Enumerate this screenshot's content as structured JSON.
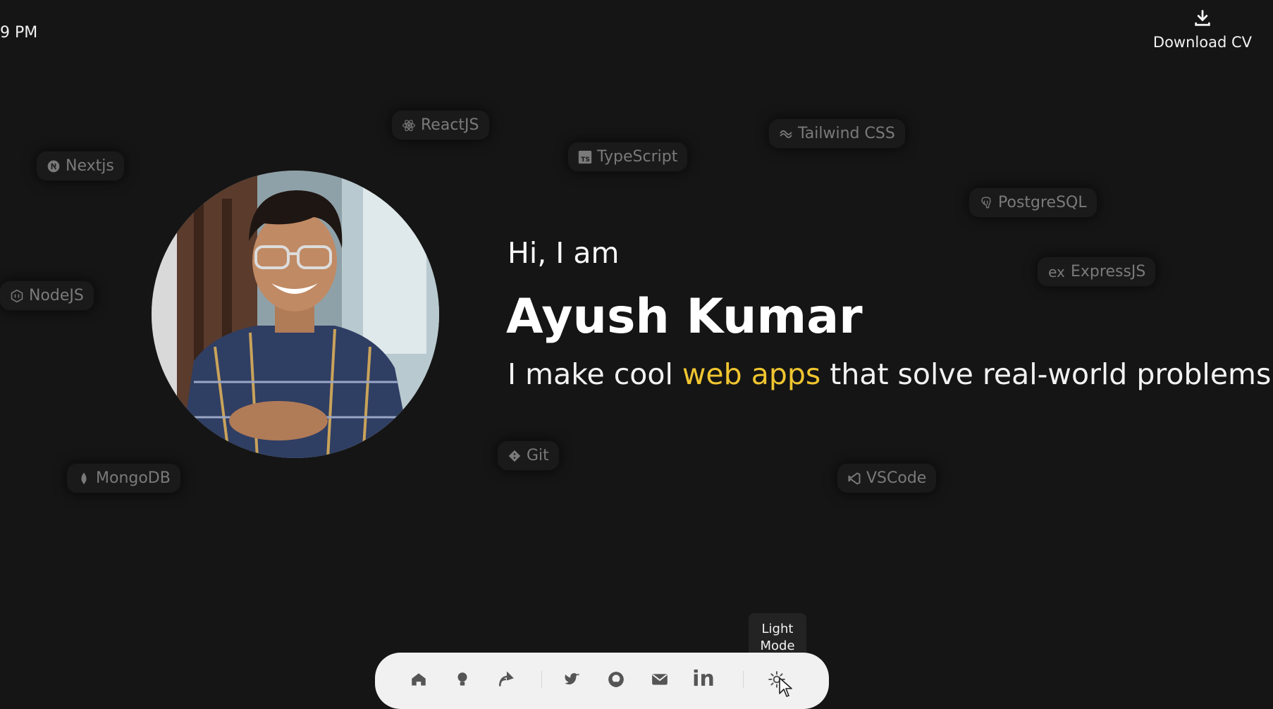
{
  "clock": {
    "time": "9 PM"
  },
  "header": {
    "download_label": "Download CV"
  },
  "tech_chips": [
    {
      "label": "ReactJS",
      "icon": "react-icon"
    },
    {
      "label": "Tailwind CSS",
      "icon": "tailwind-icon"
    },
    {
      "label": "TypeScript",
      "icon": "typescript-icon"
    },
    {
      "label": "Nextjs",
      "icon": "nextjs-icon"
    },
    {
      "label": "PostgreSQL",
      "icon": "postgresql-icon"
    },
    {
      "label": "ExpressJS",
      "icon": "express-icon"
    },
    {
      "label": "NodeJS",
      "icon": "nodejs-icon"
    },
    {
      "label": "Git",
      "icon": "git-icon"
    },
    {
      "label": "MongoDB",
      "icon": "mongodb-icon"
    },
    {
      "label": "VSCode",
      "icon": "vscode-icon"
    }
  ],
  "hero": {
    "greeting": "Hi, I am",
    "name": "Ayush Kumar",
    "tagline_before": "I make cool ",
    "tagline_highlight": "web apps",
    "tagline_after": " that solve real-world problems"
  },
  "tooltip": {
    "line1": "Light",
    "line2": "Mode"
  },
  "dock": {
    "items": [
      "home-icon",
      "lightbulb-icon",
      "blog-icon",
      "twitter-icon",
      "github-icon",
      "mail-icon",
      "linkedin-icon",
      "sun-icon"
    ],
    "linkedin_text": "in"
  },
  "colors": {
    "background": "#151515",
    "highlight": "#f0c530",
    "chip_text": "#7a7a7a",
    "dock": "#f1f1f1"
  }
}
